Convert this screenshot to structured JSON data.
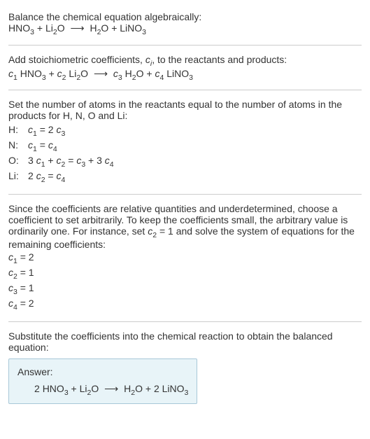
{
  "intro": {
    "line1": "Balance the chemical equation algebraically:"
  },
  "reactants": {
    "r1": "HNO",
    "r1sub": "3",
    "r2a": "Li",
    "r2asub": "2",
    "r2b": "O"
  },
  "products": {
    "p1a": "H",
    "p1asub": "2",
    "p1b": "O",
    "p2": "LiNO",
    "p2sub": "3"
  },
  "stoich": {
    "intro": "Add stoichiometric coefficients, ",
    "ci": "c",
    "cisub": "i",
    "intro2": ", to the reactants and products:"
  },
  "c": {
    "c1": "c",
    "c1sub": "1",
    "c2": "c",
    "c2sub": "2",
    "c3": "c",
    "c3sub": "3",
    "c4": "c",
    "c4sub": "4"
  },
  "atoms": {
    "intro": "Set the number of atoms in the reactants equal to the number of atoms in the products for H, N, O and Li:",
    "H": "H:",
    "Heq_a": " = 2 ",
    "N": "N:",
    "Neq_a": " = ",
    "O": "O:",
    "Oeq_a": "3 ",
    "Oeq_b": " + ",
    "Oeq_c": " = ",
    "Oeq_d": " + 3 ",
    "Li": "Li:",
    "Lieq_a": "2 ",
    "Lieq_b": " = "
  },
  "choose": {
    "text1": "Since the coefficients are relative quantities and underdetermined, choose a coefficient to set arbitrarily. To keep the coefficients small, the arbitrary value is ordinarily one. For instance, set ",
    "text2": " = 1 and solve the system of equations for the remaining coefficients:",
    "c1val": " = 2",
    "c2val": " = 1",
    "c3val": " = 1",
    "c4val": " = 2"
  },
  "substitute": {
    "text": "Substitute the coefficients into the chemical reaction to obtain the balanced equation:"
  },
  "answer": {
    "label": "Answer:",
    "coef1": "2 ",
    "plus": " + ",
    "coef2": "2 "
  },
  "arrow": "⟶"
}
